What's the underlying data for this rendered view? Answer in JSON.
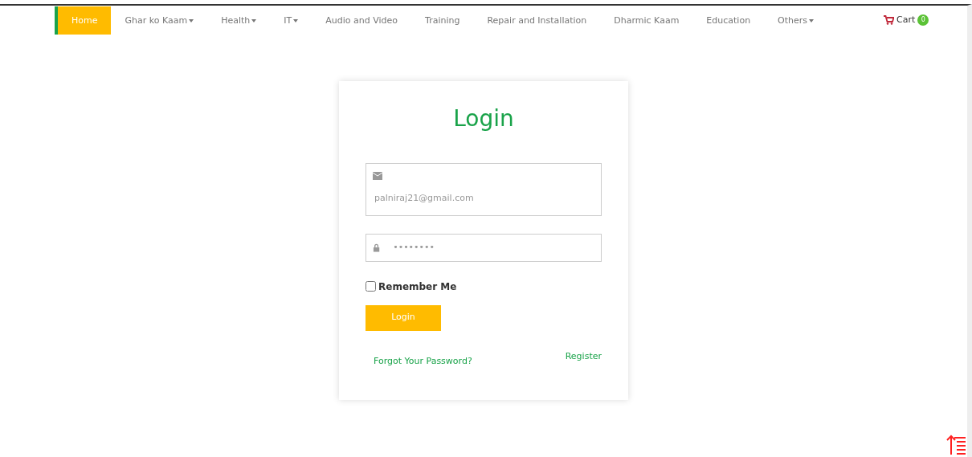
{
  "nav": [
    {
      "label": "Home",
      "selected": true,
      "dropdown": false
    },
    {
      "label": "Ghar ko Kaam",
      "selected": false,
      "dropdown": true
    },
    {
      "label": "Health",
      "selected": false,
      "dropdown": true
    },
    {
      "label": "IT",
      "selected": false,
      "dropdown": true
    },
    {
      "label": "Audio and Video",
      "selected": false,
      "dropdown": false
    },
    {
      "label": "Training",
      "selected": false,
      "dropdown": false
    },
    {
      "label": "Repair and Installation",
      "selected": false,
      "dropdown": false
    },
    {
      "label": "Dharmic Kaam",
      "selected": false,
      "dropdown": false
    },
    {
      "label": "Education",
      "selected": false,
      "dropdown": false
    },
    {
      "label": "Others",
      "selected": false,
      "dropdown": true
    }
  ],
  "cart": {
    "label": "Cart",
    "count": "0"
  },
  "login": {
    "title": "Login",
    "email": {
      "value": "palniraj21@gmail.com"
    },
    "password": {
      "value": "••••••••"
    },
    "remember": {
      "label": "Remember Me",
      "checked": false
    },
    "button": "Login",
    "forgot": "Forgot Your Password?",
    "register": "Register"
  }
}
